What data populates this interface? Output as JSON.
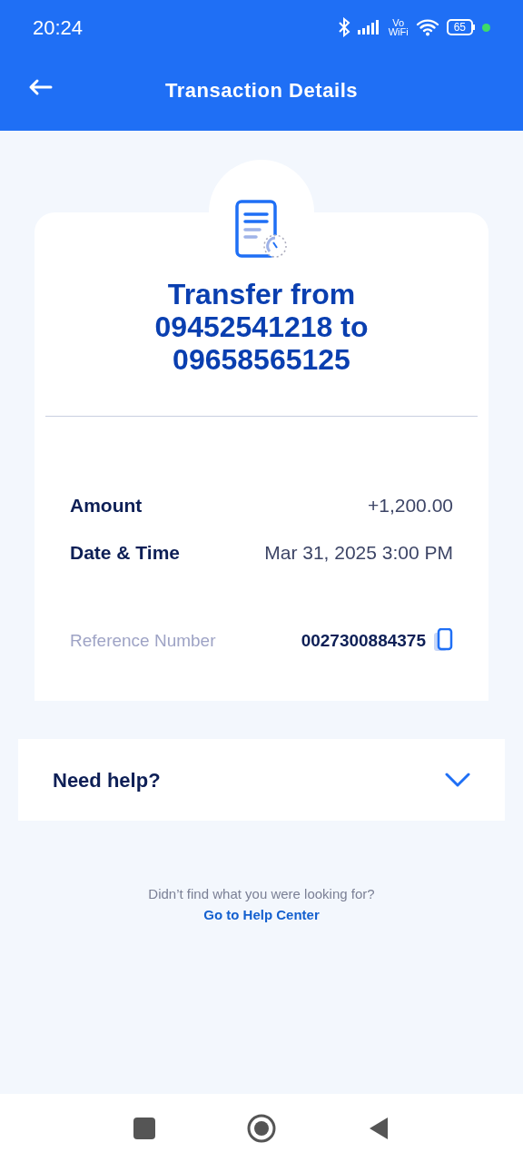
{
  "status_bar": {
    "time": "20:24",
    "vowifi_top": "Vo",
    "vowifi_bottom": "WiFi",
    "battery": "65"
  },
  "header": {
    "title": "Transaction Details"
  },
  "receipt": {
    "title": "Transfer from 09452541218 to 09658565125",
    "details": [
      {
        "label": "Amount",
        "value": "+1,200.00"
      },
      {
        "label": "Date & Time",
        "value": "Mar 31, 2025 3:00 PM"
      }
    ],
    "reference": {
      "label": "Reference Number",
      "value": "0027300884375"
    }
  },
  "help": {
    "title": "Need help?",
    "expanded": false
  },
  "footer": {
    "text": "Didn’t find what you were looking for?",
    "link": "Go to Help Center"
  }
}
